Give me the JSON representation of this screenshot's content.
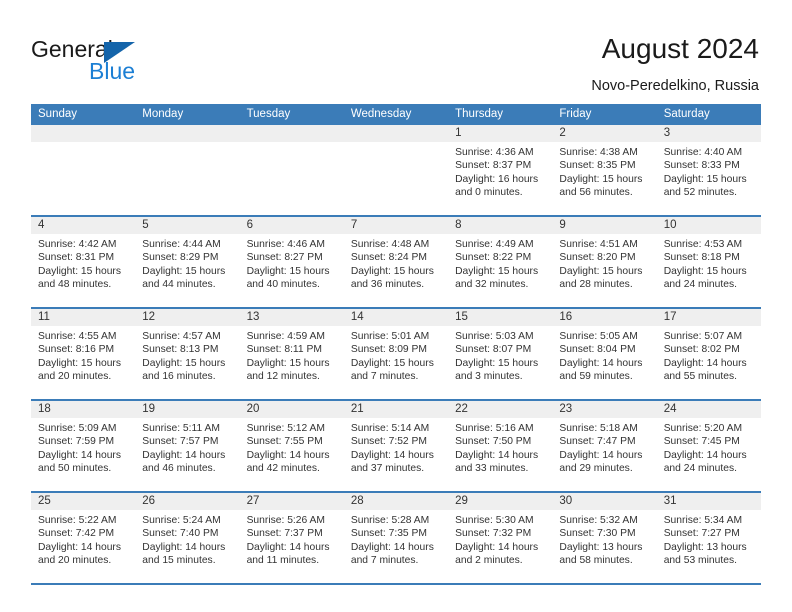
{
  "logo": {
    "word1": "General",
    "word2": "Blue",
    "triangle_color": "#1464aa",
    "word2_color": "#1c7fd4"
  },
  "header": {
    "title": "August 2024",
    "subtitle": "Novo-Peredelkino, Russia",
    "accent_color": "#3b7cb8"
  },
  "weekdays": [
    "Sunday",
    "Monday",
    "Tuesday",
    "Wednesday",
    "Thursday",
    "Friday",
    "Saturday"
  ],
  "weeks": [
    [
      {
        "day": "",
        "lines": []
      },
      {
        "day": "",
        "lines": []
      },
      {
        "day": "",
        "lines": []
      },
      {
        "day": "",
        "lines": []
      },
      {
        "day": "1",
        "lines": [
          "Sunrise: 4:36 AM",
          "Sunset: 8:37 PM",
          "Daylight: 16 hours",
          "and 0 minutes."
        ]
      },
      {
        "day": "2",
        "lines": [
          "Sunrise: 4:38 AM",
          "Sunset: 8:35 PM",
          "Daylight: 15 hours",
          "and 56 minutes."
        ]
      },
      {
        "day": "3",
        "lines": [
          "Sunrise: 4:40 AM",
          "Sunset: 8:33 PM",
          "Daylight: 15 hours",
          "and 52 minutes."
        ]
      }
    ],
    [
      {
        "day": "4",
        "lines": [
          "Sunrise: 4:42 AM",
          "Sunset: 8:31 PM",
          "Daylight: 15 hours",
          "and 48 minutes."
        ]
      },
      {
        "day": "5",
        "lines": [
          "Sunrise: 4:44 AM",
          "Sunset: 8:29 PM",
          "Daylight: 15 hours",
          "and 44 minutes."
        ]
      },
      {
        "day": "6",
        "lines": [
          "Sunrise: 4:46 AM",
          "Sunset: 8:27 PM",
          "Daylight: 15 hours",
          "and 40 minutes."
        ]
      },
      {
        "day": "7",
        "lines": [
          "Sunrise: 4:48 AM",
          "Sunset: 8:24 PM",
          "Daylight: 15 hours",
          "and 36 minutes."
        ]
      },
      {
        "day": "8",
        "lines": [
          "Sunrise: 4:49 AM",
          "Sunset: 8:22 PM",
          "Daylight: 15 hours",
          "and 32 minutes."
        ]
      },
      {
        "day": "9",
        "lines": [
          "Sunrise: 4:51 AM",
          "Sunset: 8:20 PM",
          "Daylight: 15 hours",
          "and 28 minutes."
        ]
      },
      {
        "day": "10",
        "lines": [
          "Sunrise: 4:53 AM",
          "Sunset: 8:18 PM",
          "Daylight: 15 hours",
          "and 24 minutes."
        ]
      }
    ],
    [
      {
        "day": "11",
        "lines": [
          "Sunrise: 4:55 AM",
          "Sunset: 8:16 PM",
          "Daylight: 15 hours",
          "and 20 minutes."
        ]
      },
      {
        "day": "12",
        "lines": [
          "Sunrise: 4:57 AM",
          "Sunset: 8:13 PM",
          "Daylight: 15 hours",
          "and 16 minutes."
        ]
      },
      {
        "day": "13",
        "lines": [
          "Sunrise: 4:59 AM",
          "Sunset: 8:11 PM",
          "Daylight: 15 hours",
          "and 12 minutes."
        ]
      },
      {
        "day": "14",
        "lines": [
          "Sunrise: 5:01 AM",
          "Sunset: 8:09 PM",
          "Daylight: 15 hours",
          "and 7 minutes."
        ]
      },
      {
        "day": "15",
        "lines": [
          "Sunrise: 5:03 AM",
          "Sunset: 8:07 PM",
          "Daylight: 15 hours",
          "and 3 minutes."
        ]
      },
      {
        "day": "16",
        "lines": [
          "Sunrise: 5:05 AM",
          "Sunset: 8:04 PM",
          "Daylight: 14 hours",
          "and 59 minutes."
        ]
      },
      {
        "day": "17",
        "lines": [
          "Sunrise: 5:07 AM",
          "Sunset: 8:02 PM",
          "Daylight: 14 hours",
          "and 55 minutes."
        ]
      }
    ],
    [
      {
        "day": "18",
        "lines": [
          "Sunrise: 5:09 AM",
          "Sunset: 7:59 PM",
          "Daylight: 14 hours",
          "and 50 minutes."
        ]
      },
      {
        "day": "19",
        "lines": [
          "Sunrise: 5:11 AM",
          "Sunset: 7:57 PM",
          "Daylight: 14 hours",
          "and 46 minutes."
        ]
      },
      {
        "day": "20",
        "lines": [
          "Sunrise: 5:12 AM",
          "Sunset: 7:55 PM",
          "Daylight: 14 hours",
          "and 42 minutes."
        ]
      },
      {
        "day": "21",
        "lines": [
          "Sunrise: 5:14 AM",
          "Sunset: 7:52 PM",
          "Daylight: 14 hours",
          "and 37 minutes."
        ]
      },
      {
        "day": "22",
        "lines": [
          "Sunrise: 5:16 AM",
          "Sunset: 7:50 PM",
          "Daylight: 14 hours",
          "and 33 minutes."
        ]
      },
      {
        "day": "23",
        "lines": [
          "Sunrise: 5:18 AM",
          "Sunset: 7:47 PM",
          "Daylight: 14 hours",
          "and 29 minutes."
        ]
      },
      {
        "day": "24",
        "lines": [
          "Sunrise: 5:20 AM",
          "Sunset: 7:45 PM",
          "Daylight: 14 hours",
          "and 24 minutes."
        ]
      }
    ],
    [
      {
        "day": "25",
        "lines": [
          "Sunrise: 5:22 AM",
          "Sunset: 7:42 PM",
          "Daylight: 14 hours",
          "and 20 minutes."
        ]
      },
      {
        "day": "26",
        "lines": [
          "Sunrise: 5:24 AM",
          "Sunset: 7:40 PM",
          "Daylight: 14 hours",
          "and 15 minutes."
        ]
      },
      {
        "day": "27",
        "lines": [
          "Sunrise: 5:26 AM",
          "Sunset: 7:37 PM",
          "Daylight: 14 hours",
          "and 11 minutes."
        ]
      },
      {
        "day": "28",
        "lines": [
          "Sunrise: 5:28 AM",
          "Sunset: 7:35 PM",
          "Daylight: 14 hours",
          "and 7 minutes."
        ]
      },
      {
        "day": "29",
        "lines": [
          "Sunrise: 5:30 AM",
          "Sunset: 7:32 PM",
          "Daylight: 14 hours",
          "and 2 minutes."
        ]
      },
      {
        "day": "30",
        "lines": [
          "Sunrise: 5:32 AM",
          "Sunset: 7:30 PM",
          "Daylight: 13 hours",
          "and 58 minutes."
        ]
      },
      {
        "day": "31",
        "lines": [
          "Sunrise: 5:34 AM",
          "Sunset: 7:27 PM",
          "Daylight: 13 hours",
          "and 53 minutes."
        ]
      }
    ]
  ]
}
